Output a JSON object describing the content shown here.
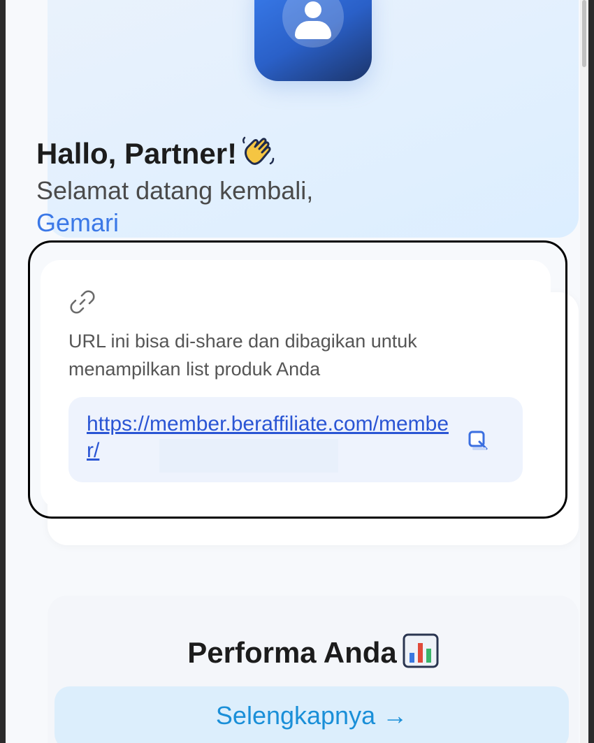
{
  "welcome": {
    "greeting": "Hallo, Partner!",
    "wave_icon": "waving-hand-icon",
    "subtitle": "Selamat datang kembali,",
    "username": "Gemari"
  },
  "share_url": {
    "link_icon": "link-icon",
    "description": "URL ini bisa di-share dan dibagikan untuk menampilkan list produk Anda",
    "url": "https://member.beraffiliate.com/member/",
    "copy_icon": "copy-icon"
  },
  "performance": {
    "title": "Performa Anda",
    "chart_icon": "bar-chart-icon",
    "more_label": "Selengkapnya →"
  },
  "colors": {
    "accent": "#3b78e7",
    "link": "#2a55d4",
    "button_bg": "#dceefc",
    "button_text": "#1a8fd8"
  }
}
